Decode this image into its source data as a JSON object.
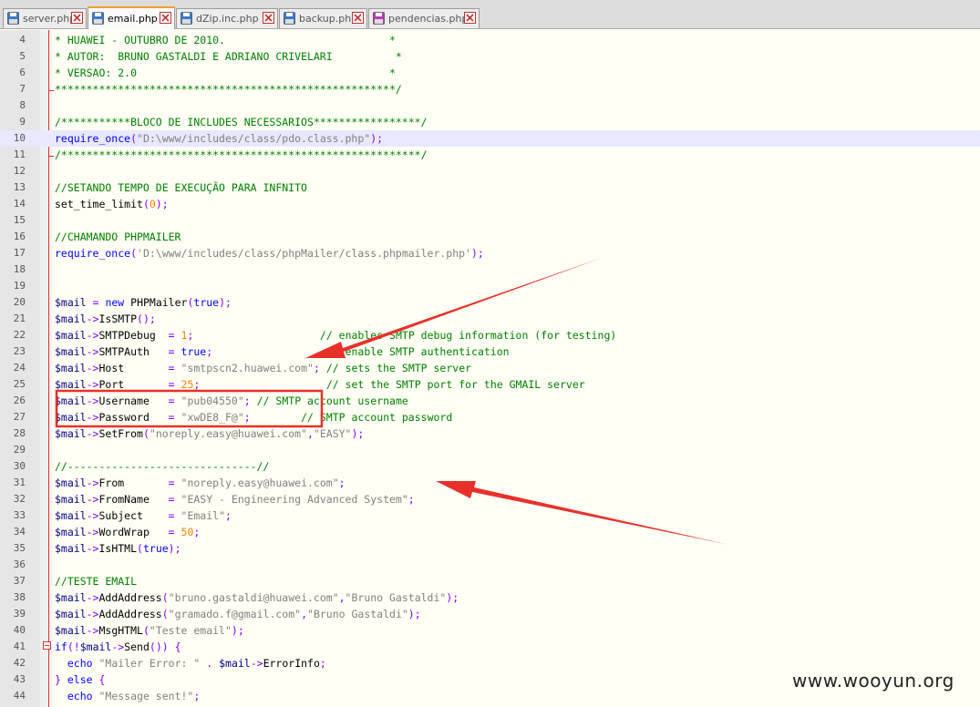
{
  "tabs": [
    {
      "label": "server.php",
      "icon": "saved-file-icon",
      "active": false
    },
    {
      "label": "email.php",
      "icon": "saved-file-icon",
      "active": true
    },
    {
      "label": "dZip.inc.php",
      "icon": "saved-file-icon",
      "active": false
    },
    {
      "label": "backup.php",
      "icon": "saved-file-icon",
      "active": false
    },
    {
      "label": "pendencias.php",
      "icon": "unsaved-file-icon",
      "active": false
    }
  ],
  "colors": {
    "tab_accent": "#f0a030",
    "line_highlight": "#e8e8ff",
    "fold_marker": "#e03030",
    "annotation_red": "#e8302a"
  },
  "editor": {
    "highlighted_line": 10,
    "lines": [
      {
        "n": 4,
        "tokens": [
          [
            "comment",
            "* HUAWEI - OUTUBRO DE 2010.                          *"
          ]
        ]
      },
      {
        "n": 5,
        "tokens": [
          [
            "comment",
            "* AUTOR:  BRUNO GASTALDI E ADRIANO CRIVELARI          *"
          ]
        ]
      },
      {
        "n": 6,
        "tokens": [
          [
            "comment",
            "* VERSAO: 2.0                                        *"
          ]
        ]
      },
      {
        "n": 7,
        "tokens": [
          [
            "comment",
            "******************************************************/"
          ]
        ]
      },
      {
        "n": 8,
        "tokens": []
      },
      {
        "n": 9,
        "tokens": [
          [
            "comment",
            "/***********BLOCO DE INCLUDES NECESSARIOS*****************/"
          ]
        ]
      },
      {
        "n": 10,
        "tokens": [
          [
            "kw",
            "require_once"
          ],
          [
            "op",
            "("
          ],
          [
            "str",
            "\"D:\\www/includes/class/pdo.class.php\""
          ],
          [
            "op",
            ");"
          ]
        ]
      },
      {
        "n": 11,
        "tokens": [
          [
            "comment",
            "/*********************************************************/"
          ]
        ]
      },
      {
        "n": 12,
        "tokens": []
      },
      {
        "n": 13,
        "tokens": [
          [
            "comment",
            "//SETANDO TEMPO DE EXECUÇÃO PARA INFNITO"
          ]
        ]
      },
      {
        "n": 14,
        "tokens": [
          [
            "fn",
            "set_time_limit"
          ],
          [
            "op",
            "("
          ],
          [
            "num",
            "0"
          ],
          [
            "op",
            ");"
          ]
        ]
      },
      {
        "n": 15,
        "tokens": []
      },
      {
        "n": 16,
        "tokens": [
          [
            "comment",
            "//CHAMANDO PHPMAILER"
          ]
        ]
      },
      {
        "n": 17,
        "tokens": [
          [
            "kw",
            "require_once"
          ],
          [
            "op",
            "("
          ],
          [
            "str",
            "'D:\\www/includes/class/phpMailer/class.phpmailer.php'"
          ],
          [
            "op",
            ");"
          ]
        ]
      },
      {
        "n": 18,
        "tokens": []
      },
      {
        "n": 19,
        "tokens": []
      },
      {
        "n": 20,
        "tokens": [
          [
            "var",
            "$mail"
          ],
          [
            "fn",
            " "
          ],
          [
            "op",
            "="
          ],
          [
            "fn",
            " "
          ],
          [
            "kw",
            "new"
          ],
          [
            "fn",
            " PHPMailer"
          ],
          [
            "op",
            "("
          ],
          [
            "kw",
            "true"
          ],
          [
            "op",
            ");"
          ]
        ]
      },
      {
        "n": 21,
        "tokens": [
          [
            "var",
            "$mail"
          ],
          [
            "op",
            "->"
          ],
          [
            "fn",
            "IsSMTP"
          ],
          [
            "op",
            "();"
          ]
        ]
      },
      {
        "n": 22,
        "tokens": [
          [
            "var",
            "$mail"
          ],
          [
            "op",
            "->"
          ],
          [
            "fn",
            "SMTPDebug  "
          ],
          [
            "op",
            "="
          ],
          [
            "fn",
            " "
          ],
          [
            "num",
            "1"
          ],
          [
            "op",
            ";"
          ],
          [
            "fn",
            "                    "
          ],
          [
            "comment",
            "// enables SMTP debug information (for testing)"
          ]
        ]
      },
      {
        "n": 23,
        "tokens": [
          [
            "var",
            "$mail"
          ],
          [
            "op",
            "->"
          ],
          [
            "fn",
            "SMTPAuth   "
          ],
          [
            "op",
            "="
          ],
          [
            "fn",
            " "
          ],
          [
            "kw",
            "true"
          ],
          [
            "op",
            ";"
          ],
          [
            "fn",
            "                  "
          ],
          [
            "comment",
            "// enable SMTP authentication"
          ]
        ]
      },
      {
        "n": 24,
        "tokens": [
          [
            "var",
            "$mail"
          ],
          [
            "op",
            "->"
          ],
          [
            "fn",
            "Host       "
          ],
          [
            "op",
            "="
          ],
          [
            "fn",
            " "
          ],
          [
            "str",
            "\"smtpscn2.huawei.com\""
          ],
          [
            "op",
            ";"
          ],
          [
            "fn",
            " "
          ],
          [
            "comment",
            "// sets the SMTP server"
          ]
        ]
      },
      {
        "n": 25,
        "tokens": [
          [
            "var",
            "$mail"
          ],
          [
            "op",
            "->"
          ],
          [
            "fn",
            "Port       "
          ],
          [
            "op",
            "="
          ],
          [
            "fn",
            " "
          ],
          [
            "num",
            "25"
          ],
          [
            "op",
            ";"
          ],
          [
            "fn",
            "                    "
          ],
          [
            "comment",
            "// set the SMTP port for the GMAIL server"
          ]
        ]
      },
      {
        "n": 26,
        "tokens": [
          [
            "var",
            "$mail"
          ],
          [
            "op",
            "->"
          ],
          [
            "fn",
            "Username   "
          ],
          [
            "op",
            "="
          ],
          [
            "fn",
            " "
          ],
          [
            "str",
            "\"pub04550\""
          ],
          [
            "op",
            ";"
          ],
          [
            "fn",
            " "
          ],
          [
            "comment",
            "// SMTP account username"
          ]
        ]
      },
      {
        "n": 27,
        "tokens": [
          [
            "var",
            "$mail"
          ],
          [
            "op",
            "->"
          ],
          [
            "fn",
            "Password   "
          ],
          [
            "op",
            "="
          ],
          [
            "fn",
            " "
          ],
          [
            "str",
            "\"xwDE8_F@\""
          ],
          [
            "op",
            ";"
          ],
          [
            "fn",
            "        "
          ],
          [
            "comment",
            "// SMTP account password"
          ]
        ]
      },
      {
        "n": 28,
        "tokens": [
          [
            "var",
            "$mail"
          ],
          [
            "op",
            "->"
          ],
          [
            "fn",
            "SetFrom"
          ],
          [
            "op",
            "("
          ],
          [
            "str",
            "\"noreply.easy@huawei.com\""
          ],
          [
            "op",
            ","
          ],
          [
            "str",
            "\"EASY\""
          ],
          [
            "op",
            ");"
          ]
        ]
      },
      {
        "n": 29,
        "tokens": []
      },
      {
        "n": 30,
        "tokens": [
          [
            "comment",
            "//------------------------------//"
          ]
        ]
      },
      {
        "n": 31,
        "tokens": [
          [
            "var",
            "$mail"
          ],
          [
            "op",
            "->"
          ],
          [
            "fn",
            "From       "
          ],
          [
            "op",
            "="
          ],
          [
            "fn",
            " "
          ],
          [
            "str",
            "\"noreply.easy@huawei.com\""
          ],
          [
            "op",
            ";"
          ]
        ]
      },
      {
        "n": 32,
        "tokens": [
          [
            "var",
            "$mail"
          ],
          [
            "op",
            "->"
          ],
          [
            "fn",
            "FromName   "
          ],
          [
            "op",
            "="
          ],
          [
            "fn",
            " "
          ],
          [
            "str",
            "\"EASY - Engineering Advanced System\""
          ],
          [
            "op",
            ";"
          ]
        ]
      },
      {
        "n": 33,
        "tokens": [
          [
            "var",
            "$mail"
          ],
          [
            "op",
            "->"
          ],
          [
            "fn",
            "Subject    "
          ],
          [
            "op",
            "="
          ],
          [
            "fn",
            " "
          ],
          [
            "str",
            "\"Email\""
          ],
          [
            "op",
            ";"
          ]
        ]
      },
      {
        "n": 34,
        "tokens": [
          [
            "var",
            "$mail"
          ],
          [
            "op",
            "->"
          ],
          [
            "fn",
            "WordWrap   "
          ],
          [
            "op",
            "="
          ],
          [
            "fn",
            " "
          ],
          [
            "num",
            "50"
          ],
          [
            "op",
            ";"
          ]
        ]
      },
      {
        "n": 35,
        "tokens": [
          [
            "var",
            "$mail"
          ],
          [
            "op",
            "->"
          ],
          [
            "fn",
            "IsHTML"
          ],
          [
            "op",
            "("
          ],
          [
            "kw",
            "true"
          ],
          [
            "op",
            ");"
          ]
        ]
      },
      {
        "n": 36,
        "tokens": []
      },
      {
        "n": 37,
        "tokens": [
          [
            "comment",
            "//TESTE EMAIL"
          ]
        ]
      },
      {
        "n": 38,
        "tokens": [
          [
            "var",
            "$mail"
          ],
          [
            "op",
            "->"
          ],
          [
            "fn",
            "AddAddress"
          ],
          [
            "op",
            "("
          ],
          [
            "str",
            "\"bruno.gastaldi@huawei.com\""
          ],
          [
            "op",
            ","
          ],
          [
            "str",
            "\"Bruno Gastaldi\""
          ],
          [
            "op",
            ");"
          ]
        ]
      },
      {
        "n": 39,
        "tokens": [
          [
            "var",
            "$mail"
          ],
          [
            "op",
            "->"
          ],
          [
            "fn",
            "AddAddress"
          ],
          [
            "op",
            "("
          ],
          [
            "str",
            "\"gramado.f@gmail.com\""
          ],
          [
            "op",
            ","
          ],
          [
            "str",
            "\"Bruno Gastaldi\""
          ],
          [
            "op",
            ");"
          ]
        ]
      },
      {
        "n": 40,
        "tokens": [
          [
            "var",
            "$mail"
          ],
          [
            "op",
            "->"
          ],
          [
            "fn",
            "MsgHTML"
          ],
          [
            "op",
            "("
          ],
          [
            "str",
            "\"Teste email\""
          ],
          [
            "op",
            ");"
          ]
        ]
      },
      {
        "n": 41,
        "tokens": [
          [
            "kw",
            "if"
          ],
          [
            "op",
            "(!"
          ],
          [
            "var",
            "$mail"
          ],
          [
            "op",
            "->"
          ],
          [
            "fn",
            "Send"
          ],
          [
            "op",
            "()) {"
          ]
        ]
      },
      {
        "n": 42,
        "tokens": [
          [
            "fn",
            "  "
          ],
          [
            "kw",
            "echo"
          ],
          [
            "fn",
            " "
          ],
          [
            "str",
            "\"Mailer Error: \""
          ],
          [
            "fn",
            " "
          ],
          [
            "op",
            "."
          ],
          [
            "fn",
            " "
          ],
          [
            "var",
            "$mail"
          ],
          [
            "op",
            "->"
          ],
          [
            "fn",
            "ErrorInfo"
          ],
          [
            "op",
            ";"
          ]
        ]
      },
      {
        "n": 43,
        "tokens": [
          [
            "op",
            "} "
          ],
          [
            "kw",
            "else"
          ],
          [
            "fn",
            " "
          ],
          [
            "op",
            "{"
          ]
        ]
      },
      {
        "n": 44,
        "tokens": [
          [
            "fn",
            "  "
          ],
          [
            "kw",
            "echo"
          ],
          [
            "fn",
            " "
          ],
          [
            "str",
            "\"Message sent!\""
          ],
          [
            "op",
            ";"
          ]
        ]
      }
    ]
  },
  "watermark": "www.wooyun.org"
}
